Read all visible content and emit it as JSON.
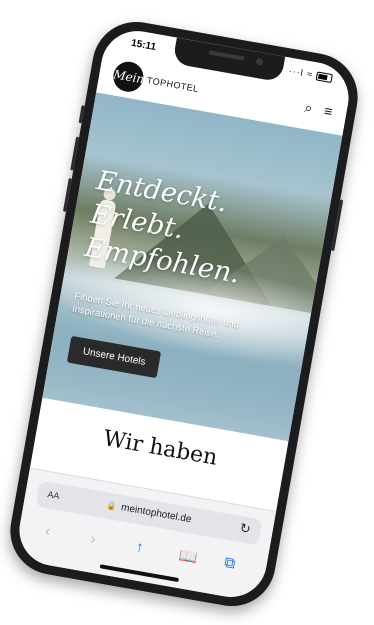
{
  "status_bar": {
    "time": "15:11",
    "signal": "···l",
    "wifi": "≈"
  },
  "site": {
    "logo_mark": "Mein",
    "logo_text": "TOPHOTEL",
    "search_icon": "⌕",
    "menu_icon": "≡"
  },
  "hero": {
    "title": "Entdeckt. Erlebt. Empfohlen.",
    "subtitle": "Finden Sie Ihr neues Lieblingshotel und Inspirationen für die nächste Reise.",
    "button_label": "Unsere Hotels"
  },
  "section": {
    "title": "Wir haben"
  },
  "browser": {
    "aa_label": "AA",
    "lock_icon": "🔒",
    "url": "meintophotel.de",
    "reload_icon": "↻",
    "back_icon": "‹",
    "forward_icon": "›",
    "share_icon": "↑",
    "bookmarks_icon": "📖",
    "tabs_icon": "⧉"
  }
}
